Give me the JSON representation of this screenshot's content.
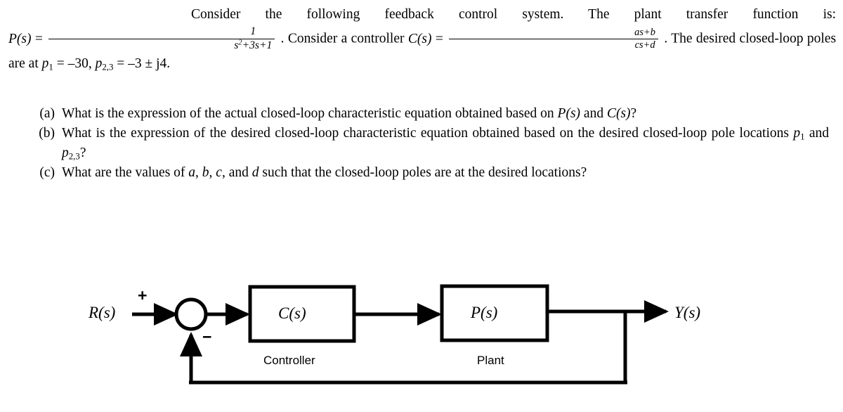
{
  "document": {
    "type": "control-systems-homework-problem",
    "statement": {
      "intro": "Consider the following feedback control system. The plant transfer function is:",
      "plant_symbol": "P(s)",
      "plant_numerator": "1",
      "plant_denominator_base": "s",
      "plant_denominator_exponent": "2",
      "plant_denominator_rest": "+3s+1",
      "period_after_plant": ".",
      "controller_phrase": "Consider a controller",
      "controller_symbol": "C(s)",
      "controller_numerator": "as+b",
      "controller_denominator": "cs+d",
      "period_after_controller": ".",
      "poles_phrase": "The desired closed-loop poles are at",
      "pole1_symbol": "p",
      "pole1_subscript": "1",
      "pole1_value": "–30,",
      "pole23_symbol": "p",
      "pole23_subscript": "2,3",
      "pole23_value": "–3 ± j4.",
      "equals": "=",
      "comma": ","
    },
    "questions": [
      {
        "label": "(a)",
        "text_before": "What is the expression of the actual closed-loop characteristic equation obtained based on ",
        "symbol_1": "P(s)",
        "text_mid": " and ",
        "symbol_2": "C(s)",
        "text_after": "?"
      },
      {
        "label": "(b)",
        "text_before": "What is the expression of the desired closed-loop characteristic equation obtained based on the desired closed-loop pole locations ",
        "symbol_1": "p",
        "symbol_1_sub": "1",
        "text_mid": " and ",
        "symbol_2": "p",
        "symbol_2_sub": "2,3",
        "text_after": "?"
      },
      {
        "label": "(c)",
        "text_before": "What are the values of ",
        "var_a": "a",
        "var_b": "b",
        "var_c": "c",
        "var_d": "d",
        "text_conj": ", and ",
        "text_after": " such that the closed-loop poles are at the desired locations?",
        "sep": ", "
      }
    ]
  },
  "diagram": {
    "title": "feedback-control-block-diagram",
    "input_label": "R(s)",
    "output_label": "Y(s)",
    "summing_plus": "+",
    "summing_minus": "−",
    "blocks": [
      {
        "name": "controller",
        "symbol": "C(s)",
        "caption": "Controller"
      },
      {
        "name": "plant",
        "symbol": "P(s)",
        "caption": "Plant"
      }
    ],
    "line_color": "#000000",
    "background": "#ffffff"
  }
}
